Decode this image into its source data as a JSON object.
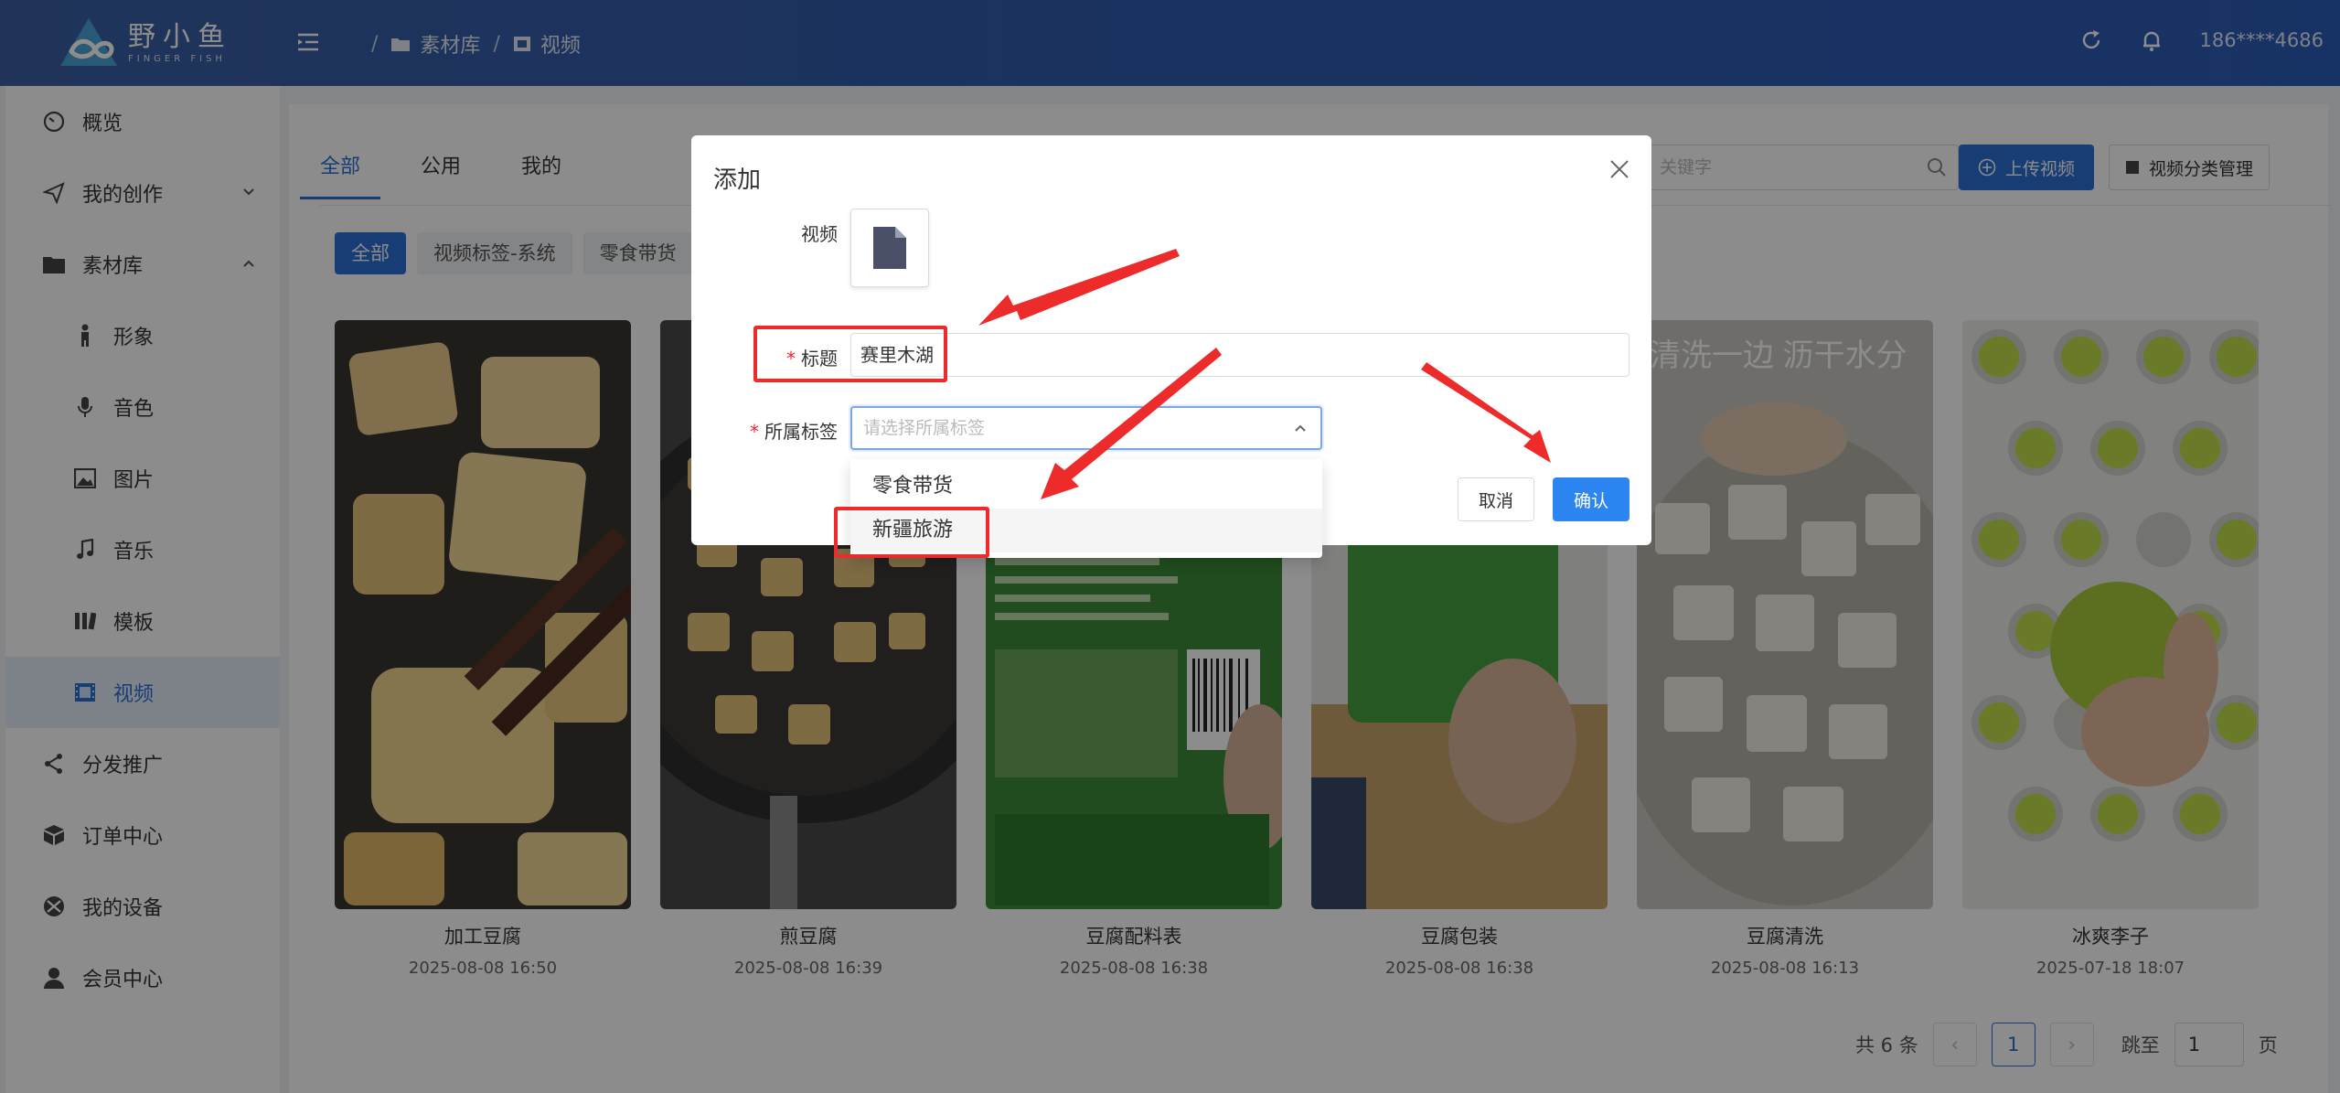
{
  "header": {
    "logo_cn": "野小鱼",
    "logo_en": "FINGER FISH",
    "breadcrumb": [
      "素材库",
      "视频"
    ],
    "user": "186****4686"
  },
  "sidebar": {
    "items": [
      {
        "label": "概览",
        "icon": "dashboard-icon"
      },
      {
        "label": "我的创作",
        "icon": "send-icon"
      },
      {
        "label": "素材库",
        "icon": "folder-icon"
      },
      {
        "label": "形象",
        "icon": "person-icon"
      },
      {
        "label": "音色",
        "icon": "microphone-icon"
      },
      {
        "label": "图片",
        "icon": "image-icon"
      },
      {
        "label": "音乐",
        "icon": "music-icon"
      },
      {
        "label": "模板",
        "icon": "template-icon"
      },
      {
        "label": "视频",
        "icon": "video-icon"
      },
      {
        "label": "分发推广",
        "icon": "share-icon"
      },
      {
        "label": "订单中心",
        "icon": "box-icon"
      },
      {
        "label": "我的设备",
        "icon": "device-icon"
      },
      {
        "label": "会员中心",
        "icon": "user-icon"
      }
    ]
  },
  "main": {
    "tabs": [
      "全部",
      "公用",
      "我的"
    ],
    "filters": [
      "全部",
      "视频标签-系统",
      "零食带货"
    ],
    "search_placeholder": "关键字",
    "upload_label": "上传视频",
    "category_label": "视频分类管理",
    "cards": [
      {
        "title": "加工豆腐",
        "date": "2025-08-08 16:50"
      },
      {
        "title": "煎豆腐",
        "date": "2025-08-08 16:39"
      },
      {
        "title": "豆腐配料表",
        "date": "2025-08-08 16:38"
      },
      {
        "title": "豆腐包装",
        "date": "2025-08-08 16:38"
      },
      {
        "title": "豆腐清洗",
        "date": "2025-08-08 16:13"
      },
      {
        "title": "冰爽李子",
        "date": "2025-07-18 18:07"
      }
    ],
    "thumb_caption": "清洗一边 沥干水分",
    "pager": {
      "total": "共 6 条",
      "current": "1",
      "jump_label": "跳至",
      "jump_value": "1",
      "page_unit": "页"
    }
  },
  "modal": {
    "title": "添加",
    "video_label": "视频",
    "title_label": "标题",
    "title_value": "赛里木湖",
    "tag_label": "所属标签",
    "tag_placeholder": "请选择所属标签",
    "options": [
      "零食带货",
      "新疆旅游"
    ],
    "cancel": "取消",
    "confirm": "确认"
  },
  "colors": {
    "accent": "#2c6fd6",
    "header": "#2f5bb0",
    "annotation": "#ee2b2b"
  }
}
